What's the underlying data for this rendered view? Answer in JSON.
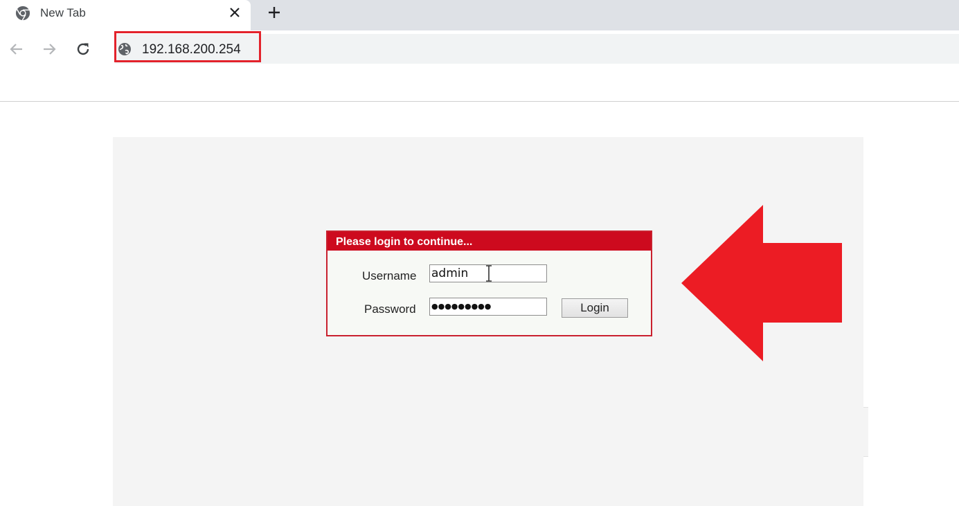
{
  "browser": {
    "tab": {
      "title": "New Tab"
    },
    "address_bar": {
      "url": "192.168.200.254"
    }
  },
  "login_form": {
    "header": "Please login to continue...",
    "username_label": "Username",
    "username_value": "admin",
    "password_label": "Password",
    "password_value": "●●●●●●●●●",
    "login_button_label": "Login"
  },
  "colors": {
    "annotation_red": "#ec1c24",
    "header_red": "#cd0a1e"
  },
  "icons": {
    "tab_favicon": "chrome-icon",
    "tab_close": "close-icon",
    "new_tab": "plus-icon",
    "back": "arrow-left-icon",
    "forward": "arrow-right-icon",
    "reload": "reload-icon",
    "site_info": "globe-icon",
    "annotation": "arrow-left-icon"
  }
}
